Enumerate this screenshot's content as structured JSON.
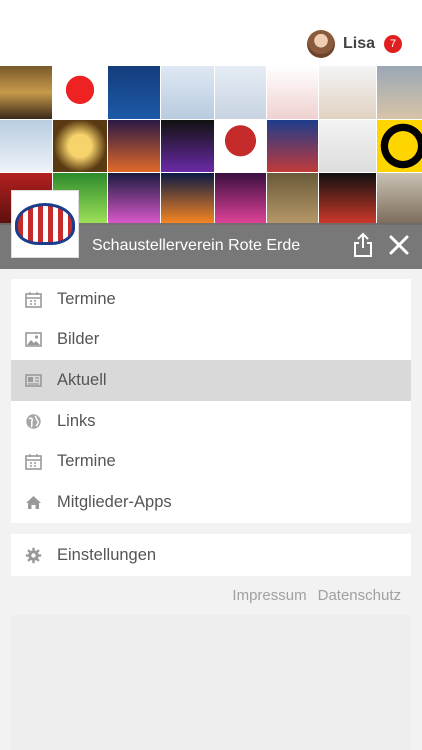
{
  "user": {
    "name": "Lisa",
    "notification_count": "7"
  },
  "header": {
    "title": "Schaustellerverein Rote Erde",
    "share_icon": "share-icon",
    "close_icon": "close-icon"
  },
  "menu": {
    "items": [
      {
        "label": "Termine",
        "icon": "calendar-icon"
      },
      {
        "label": "Bilder",
        "icon": "image-icon"
      },
      {
        "label": "Aktuell",
        "icon": "newspaper-icon",
        "active": true
      },
      {
        "label": "Links",
        "icon": "globe-icon"
      },
      {
        "label": "Termine",
        "icon": "calendar-icon"
      },
      {
        "label": "Mitglieder-Apps",
        "icon": "home-icon"
      }
    ]
  },
  "settings": {
    "label": "Einstellungen",
    "icon": "gear-icon"
  },
  "footer": {
    "impressum": "Impressum",
    "datenschutz": "Datenschutz"
  },
  "colors": {
    "badge": "#e02020",
    "header_bar": "#6e6e6e",
    "active_item": "#d9d9d9"
  }
}
